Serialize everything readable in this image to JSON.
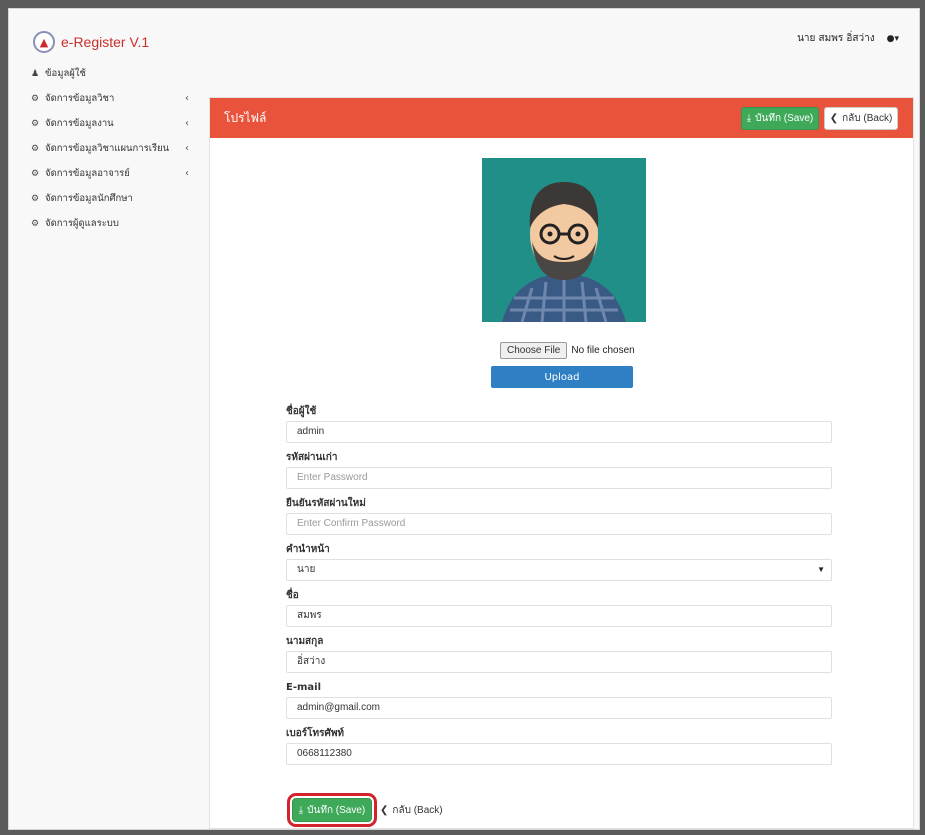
{
  "app": {
    "brand": "e-Register V.1",
    "user_name": "นาย สมพร อิ่สว่าง"
  },
  "sidebar": {
    "items": [
      {
        "label": "ข้อมูลผู้ใช้",
        "icon": "users-icon",
        "has_chevron": false
      },
      {
        "label": "จัดการข้อมูลวิชา",
        "icon": "cogs-icon",
        "has_chevron": true
      },
      {
        "label": "จัดการข้อมูลงาน",
        "icon": "cogs-icon",
        "has_chevron": true
      },
      {
        "label": "จัดการข้อมูลวิชาแผนการเรียน",
        "icon": "cogs-icon",
        "has_chevron": true
      },
      {
        "label": "จัดการข้อมูลอาจารย์",
        "icon": "cogs-icon",
        "has_chevron": true
      },
      {
        "label": "จัดการข้อมูลนักศึกษา",
        "icon": "cogs-icon",
        "has_chevron": false
      },
      {
        "label": "จัดการผู้ดูแลระบบ",
        "icon": "cogs-icon",
        "has_chevron": false
      }
    ]
  },
  "panel": {
    "title": "โปรไฟล์",
    "save_label": "บันทึก (Save)",
    "back_label": "กลับ (Back)"
  },
  "upload": {
    "choose_label": "Choose File",
    "status": "No file chosen",
    "upload_label": "Upload"
  },
  "form": {
    "username": {
      "label": "ชื่อผู้ใช้",
      "value": "admin"
    },
    "old_password": {
      "label": "รหัสผ่านเก่า",
      "placeholder": "Enter Password"
    },
    "confirm_password": {
      "label": "ยืนยันรหัสผ่านใหม่",
      "placeholder": "Enter Confirm Password"
    },
    "prefix": {
      "label": "คำนำหน้า",
      "value": "นาย"
    },
    "first_name": {
      "label": "ชื่อ",
      "value": "สมพร"
    },
    "last_name": {
      "label": "นามสกุล",
      "value": "อิ่สว่าง"
    },
    "email": {
      "label": "E-mail",
      "value": "admin@gmail.com"
    },
    "phone": {
      "label": "เบอร์โทรศัพท์",
      "value": "0668112380"
    }
  },
  "colors": {
    "header": "#e9533c",
    "save": "#3fa95a",
    "upload": "#2f7fc4",
    "highlight": "#d2232a"
  }
}
